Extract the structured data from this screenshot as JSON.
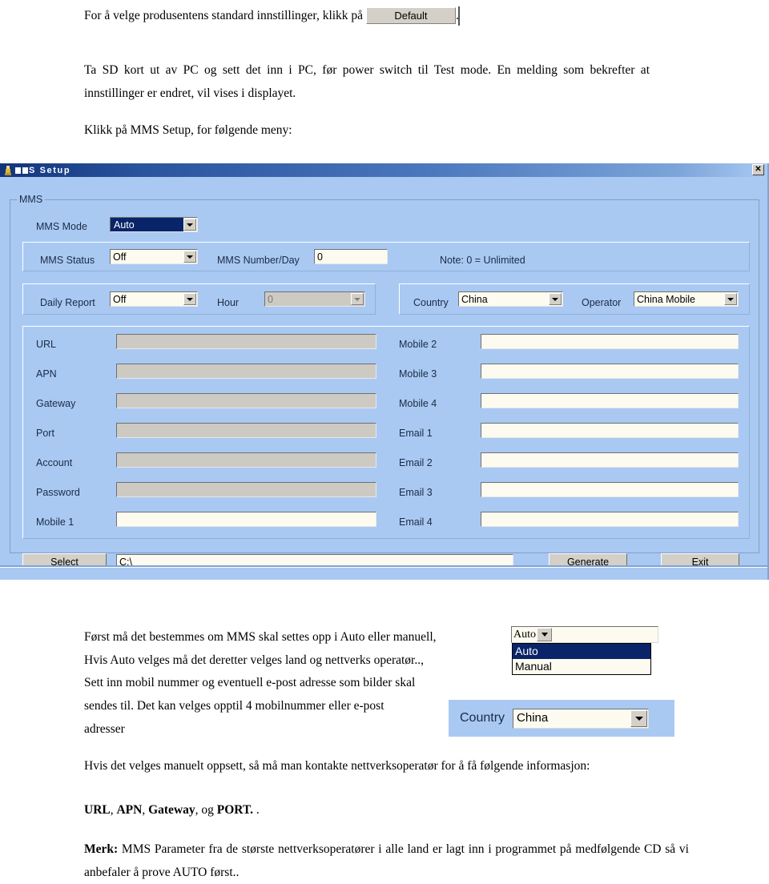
{
  "document": {
    "para1_before": "For å velge produsentens standard innstillinger, klikk på",
    "default_button_label": "Default",
    "para1_after": ".",
    "para2": "Ta SD kort ut av PC og sett det inn i PC, før power switch til Test mode. En melding som bekrefter at innstillinger er endret, vil vises i displayet.",
    "para3": "Klikk på MMS Setup, for følgende meny:",
    "para4_line1": "Først må det bestemmes om MMS skal settes opp i Auto eller manuell,",
    "para4_line2": "Hvis Auto velges må det deretter velges land og nettverks operatør..,",
    "para4_line3": "Sett inn mobil nummer og eventuell e-post adresse som bilder skal",
    "para4_line4": "sendes til. Det kan velges opptil 4 mobilnummer eller e-post",
    "para4_line5": "adresser",
    "para5": "Hvis det velges manuelt oppsett, så må man kontakte nettverksoperatør for å få følgende informasjon:",
    "para6_bold1": "URL",
    "para6_sep1": ", ",
    "para6_bold2": "APN",
    "para6_sep2": ", ",
    "para6_bold3": "Gateway",
    "para6_sep3": ", og ",
    "para6_bold4": "PORT.",
    "para6_tail": " .",
    "para7_bold": "Merk:",
    "para7": " MMS Parameter fra de største nettverksoperatører i alle land er lagt inn i programmet på medfølgende CD så vi anbefaler å prove AUTO først.."
  },
  "dialog": {
    "title": "MMS Setup",
    "title_icon": "app-icon",
    "close_label": "✕",
    "group_label": "MMS",
    "fields": {
      "mms_mode": {
        "label": "MMS Mode",
        "value": "Auto",
        "selected": true
      },
      "mms_status": {
        "label": "MMS Status",
        "value": "Off"
      },
      "mms_number_per_day": {
        "label": "MMS Number/Day",
        "value": "0"
      },
      "note": "Note: 0 = Unlimited",
      "daily_report": {
        "label": "Daily Report",
        "value": "Off"
      },
      "hour": {
        "label": "Hour",
        "value": "0",
        "disabled": true
      },
      "country": {
        "label": "Country",
        "value": "China"
      },
      "operator": {
        "label": "Operator",
        "value": "China Mobile"
      }
    },
    "left_column": [
      {
        "label": "URL",
        "value": "",
        "disabled": true
      },
      {
        "label": "APN",
        "value": "",
        "disabled": true
      },
      {
        "label": "Gateway",
        "value": "",
        "disabled": true
      },
      {
        "label": "Port",
        "value": "",
        "disabled": true
      },
      {
        "label": "Account",
        "value": "",
        "disabled": true
      },
      {
        "label": "Password",
        "value": "",
        "disabled": true
      },
      {
        "label": "Mobile 1",
        "value": "",
        "disabled": false
      }
    ],
    "right_column": [
      {
        "label": "Mobile 2",
        "value": "",
        "disabled": false
      },
      {
        "label": "Mobile 3",
        "value": "",
        "disabled": false
      },
      {
        "label": "Mobile 4",
        "value": "",
        "disabled": false
      },
      {
        "label": "Email 1",
        "value": "",
        "disabled": false
      },
      {
        "label": "Email 2",
        "value": "",
        "disabled": false
      },
      {
        "label": "Email 3",
        "value": "",
        "disabled": false
      },
      {
        "label": "Email 4",
        "value": "",
        "disabled": false
      }
    ],
    "footer": {
      "select_label": "Select",
      "path_value": "C:\\",
      "generate_label": "Generate",
      "exit_label": "Exit"
    }
  },
  "snippets": {
    "mode_dropdown": {
      "current": "Auto",
      "options": [
        "Auto",
        "Manual"
      ],
      "selected_index": 0
    },
    "country_dropdown": {
      "label": "Country",
      "value": "China"
    }
  },
  "colors": {
    "dialog_bg": "#a9c9f3",
    "titlebar_dark": "#12347c",
    "field_bg": "#fdfbf0",
    "field_disabled_bg": "#cdcac4",
    "button_face": "#d4d0c8",
    "selection": "#0a246a",
    "label_text": "#1b2b44"
  }
}
